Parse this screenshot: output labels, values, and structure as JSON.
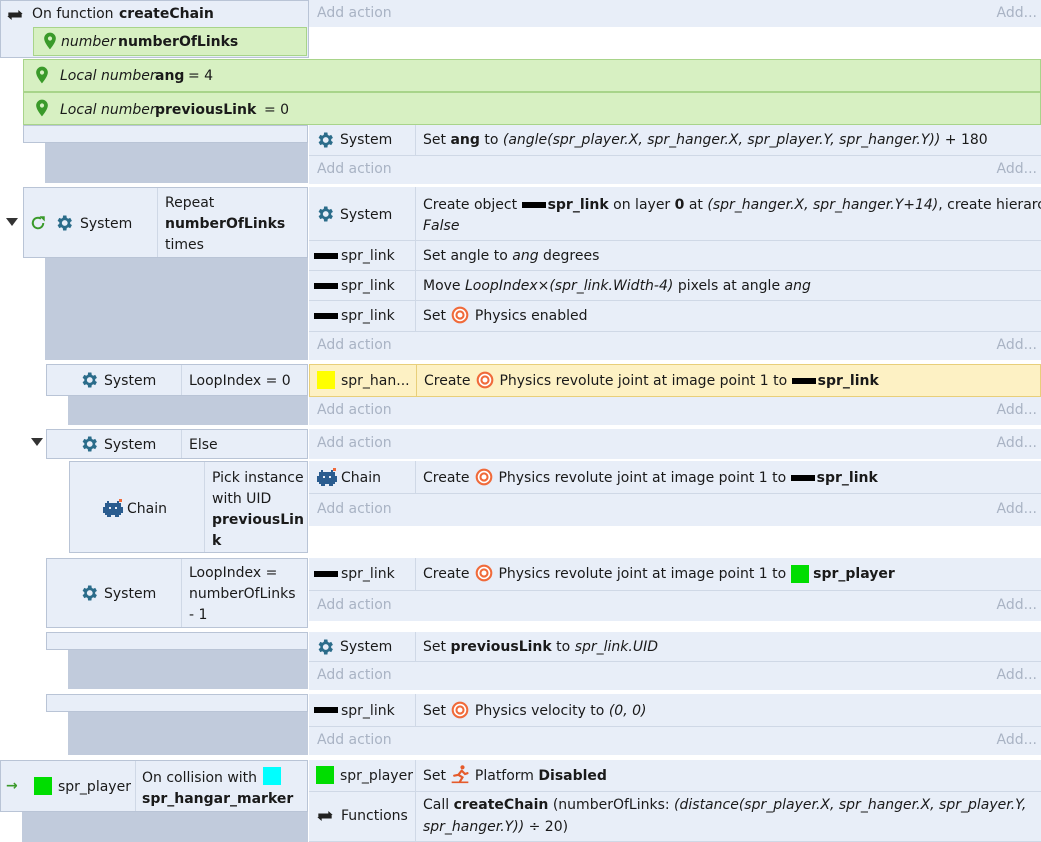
{
  "common": {
    "add_action": "Add action",
    "add_more": "Add...",
    "system": "System",
    "spr_link": "spr_link",
    "spr_player": "spr_player",
    "physics": "Physics"
  },
  "colors": {
    "condition_bg": "#e8eef8",
    "gap_bg": "#c1cbdc",
    "param_green": "#d7f0c2",
    "highlight": "#fdf1c4",
    "sprite_yellow": "#ffff00",
    "sprite_green": "#00dd00",
    "sprite_cyan": "#00ffff"
  },
  "function": {
    "prefix": "On function",
    "name": "createChain",
    "param_type": "number",
    "param_name": "numberOfLinks"
  },
  "locals": [
    {
      "type": "Local number",
      "name": "ang",
      "value": "= 4"
    },
    {
      "type": "Local number",
      "name": "previousLink",
      "value": "= 0"
    }
  ],
  "event1": {
    "set": "Set",
    "var": "ang",
    "to": "to",
    "expr": "(angle(spr_player.X, spr_hanger.X, spr_player.Y, spr_hanger.Y))",
    "suffix": "+ 180"
  },
  "event2": {
    "cond_object": "System",
    "repeat": "Repeat",
    "count": "numberOfLinks",
    "times": "times",
    "a1": {
      "create": "Create object",
      "obj": "spr_link",
      "on_layer": "on layer",
      "layer": "0",
      "at": "at",
      "expr": "(spr_hanger.X, spr_hanger.Y+14)",
      "ch": ", create hierarchy:",
      "val": "False"
    },
    "a2": {
      "set_angle": "Set angle to",
      "var": "ang",
      "deg": "degrees"
    },
    "a3": {
      "move": "Move",
      "expr": "LoopIndex×(spr_link.Width-4)",
      "px": "pixels at angle",
      "var": "ang"
    },
    "a4": {
      "set": "Set",
      "enabled": "enabled"
    }
  },
  "event3": {
    "cond": "LoopIndex = 0",
    "obj": "spr_han...",
    "create": "Create",
    "joint": "revolute joint at image point 1 to",
    "target": "spr_link"
  },
  "event4": {
    "cond": "Else"
  },
  "event5": {
    "obj": "Chain",
    "pick1": "Pick instance",
    "pick2": "with UID",
    "pick3": "previousLin",
    "pick4": "k",
    "action_obj": "Chain",
    "create": "Create",
    "joint": "revolute joint at image point 1 to",
    "target": "spr_link"
  },
  "event6": {
    "cond1": "LoopIndex =",
    "cond2": "numberOfLinks",
    "cond3": "- 1",
    "create": "Create",
    "joint": "revolute joint at image point 1 to",
    "target": "spr_player"
  },
  "event7": {
    "set": "Set",
    "var": "previousLink",
    "to": "to",
    "expr": "spr_link.UID"
  },
  "event8": {
    "set": "Set",
    "velocity": "velocity to",
    "expr": "(0, 0)"
  },
  "event9": {
    "obj": "spr_player",
    "cond1": "On collision with",
    "cond2": "spr_hangar_marker",
    "set": "Set",
    "platform": "Platform",
    "disabled": "Disabled",
    "functions": "Functions",
    "call": "Call",
    "fn": "createChain",
    "arg": "(numberOfLinks:",
    "expr1": "(distance(spr_player.X, spr_hanger.X, spr_player.Y,",
    "expr2": "spr_hanger.Y))",
    "suffix": "÷ 20)"
  }
}
